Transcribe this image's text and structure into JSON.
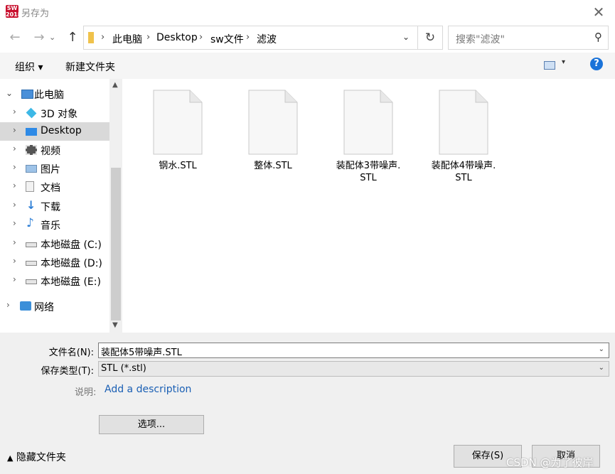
{
  "window": {
    "title": "另存为",
    "app_icon_text": "SW\n2018"
  },
  "address": {
    "crumbs": [
      "此电脑",
      "Desktop",
      "sw文件",
      "滤波"
    ]
  },
  "search": {
    "placeholder": "搜索\"滤波\""
  },
  "toolbar": {
    "organize": "组织 ▾",
    "new_folder": "新建文件夹"
  },
  "nav": {
    "items": [
      {
        "label": "此电脑",
        "icon": "computer-icon",
        "expanded": true
      },
      {
        "label": "3D 对象",
        "icon": "3d-objects-icon"
      },
      {
        "label": "Desktop",
        "icon": "desktop-icon",
        "selected": true
      },
      {
        "label": "视频",
        "icon": "video-icon"
      },
      {
        "label": "图片",
        "icon": "pictures-icon"
      },
      {
        "label": "文档",
        "icon": "documents-icon"
      },
      {
        "label": "下载",
        "icon": "download-icon"
      },
      {
        "label": "音乐",
        "icon": "music-icon"
      },
      {
        "label": "本地磁盘 (C:)",
        "icon": "drive-icon"
      },
      {
        "label": "本地磁盘 (D:)",
        "icon": "drive-icon"
      },
      {
        "label": "本地磁盘 (E:)",
        "icon": "drive-icon"
      },
      {
        "label": "网络",
        "icon": "network-icon"
      }
    ]
  },
  "files": [
    {
      "name": "钢水.STL"
    },
    {
      "name": "整体.STL"
    },
    {
      "name": "装配体3带噪声.\nSTL"
    },
    {
      "name": "装配体4带噪声.\nSTL"
    }
  ],
  "form": {
    "filename_label": "文件名(N):",
    "filename_value": "装配体5带噪声.STL",
    "type_label": "保存类型(T):",
    "type_value": "STL (*.stl)",
    "desc_label": "说明:",
    "desc_link": "Add a description",
    "options_button": "选项...",
    "hide_folders": "隐藏文件夹",
    "save_button": "保存(S)",
    "cancel_button": "取消"
  },
  "watermark": "CSDN @为了彼岸",
  "colors": {
    "accent": "#1a73d9",
    "link": "#1a5fb4",
    "folder": "#f0c24b"
  }
}
